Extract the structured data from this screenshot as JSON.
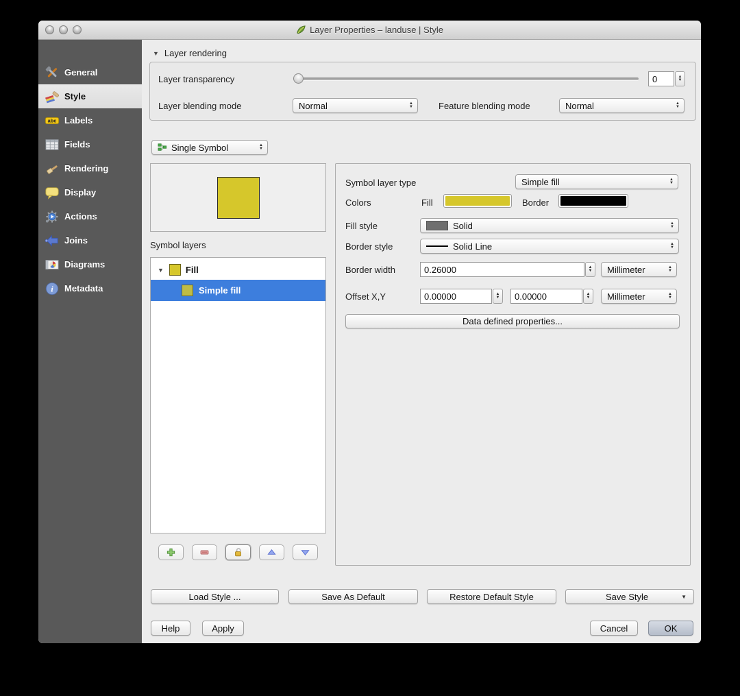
{
  "window": {
    "title": "Layer Properties – landuse | Style"
  },
  "sidebar": {
    "items": [
      {
        "label": "General"
      },
      {
        "label": "Style"
      },
      {
        "label": "Labels"
      },
      {
        "label": "Fields"
      },
      {
        "label": "Rendering"
      },
      {
        "label": "Display"
      },
      {
        "label": "Actions"
      },
      {
        "label": "Joins"
      },
      {
        "label": "Diagrams"
      },
      {
        "label": "Metadata"
      }
    ]
  },
  "layer_rendering": {
    "section_label": "Layer rendering",
    "transparency_label": "Layer transparency",
    "transparency_value": "0",
    "layer_blending_label": "Layer blending mode",
    "layer_blending_value": "Normal",
    "feature_blending_label": "Feature blending mode",
    "feature_blending_value": "Normal"
  },
  "symbol": {
    "renderer_value": "Single Symbol",
    "symbol_layers_label": "Symbol layers",
    "tree": [
      {
        "label": "Fill"
      },
      {
        "label": "Simple fill"
      }
    ]
  },
  "properties": {
    "symbol_layer_type_label": "Symbol layer type",
    "symbol_layer_type_value": "Simple fill",
    "colors_label": "Colors",
    "fill_label": "Fill",
    "border_label": "Border",
    "fill_style_label": "Fill style",
    "fill_style_value": "Solid",
    "border_style_label": "Border style",
    "border_style_value": "Solid Line",
    "border_width_label": "Border width",
    "border_width_value": "0.26000",
    "border_width_unit": "Millimeter",
    "offset_label": "Offset X,Y",
    "offset_x_value": "0.00000",
    "offset_y_value": "0.00000",
    "offset_unit": "Millimeter",
    "data_defined_button": "Data defined properties..."
  },
  "style_buttons": {
    "load_style": "Load Style ...",
    "save_as_default": "Save As Default",
    "restore_default": "Restore Default Style",
    "save_style": "Save Style"
  },
  "dialog_buttons": {
    "help": "Help",
    "apply": "Apply",
    "cancel": "Cancel",
    "ok": "OK"
  },
  "colors": {
    "fill": "#d6c72b",
    "border": "#000000",
    "selection": "#3d7edd",
    "sidebar_bg": "#595959",
    "fill_style_swatch": "#6f6f6f"
  }
}
